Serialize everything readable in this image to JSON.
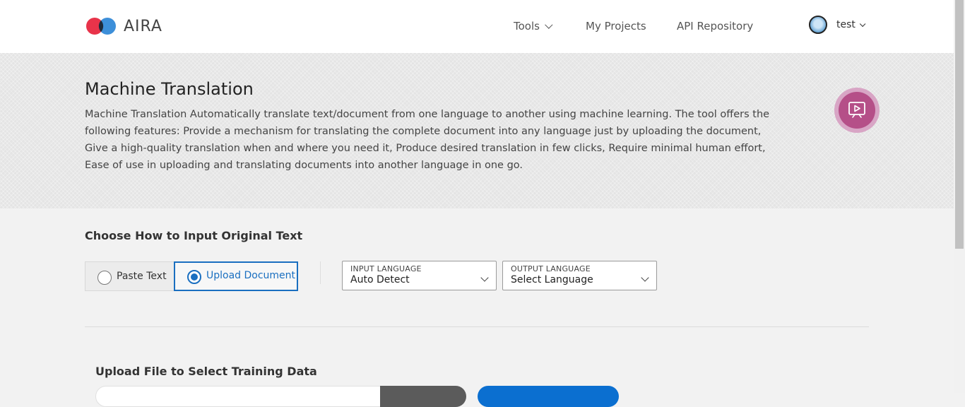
{
  "header": {
    "brand": "AIRA",
    "logo_colors": [
      "#e8334a",
      "#3d8fd9",
      "#1e2a3a"
    ],
    "nav": [
      {
        "label": "Tools"
      },
      {
        "label": "My Projects"
      },
      {
        "label": "API Repository"
      }
    ],
    "user": {
      "name": "test"
    }
  },
  "hero": {
    "title": "Machine Translation",
    "description": "Machine Translation Automatically translate text/document from one language to another using machine learning. The tool offers the following features: Provide a mechanism for translating the complete document into any language just by uploading the document, Give a high-quality translation when and where you need it, Produce desired translation in few clicks, Require minimal human effort, Ease of use in uploading and translating documents into another language in one go.",
    "video_icon": "play-presentation-icon",
    "accent": "#b54f88"
  },
  "input_section": {
    "title": "Choose How to Input Original Text",
    "options": [
      {
        "label": "Paste Text",
        "selected": false
      },
      {
        "label": "Upload Document",
        "selected": true
      }
    ],
    "input_language": {
      "label": "INPUT LANGUAGE",
      "value": "Auto Detect"
    },
    "output_language": {
      "label": "OUTPUT LANGUAGE",
      "value": "Select Language"
    },
    "accent": "#1a6fc0"
  },
  "upload_section": {
    "title": "Upload File to Select Training Data"
  }
}
